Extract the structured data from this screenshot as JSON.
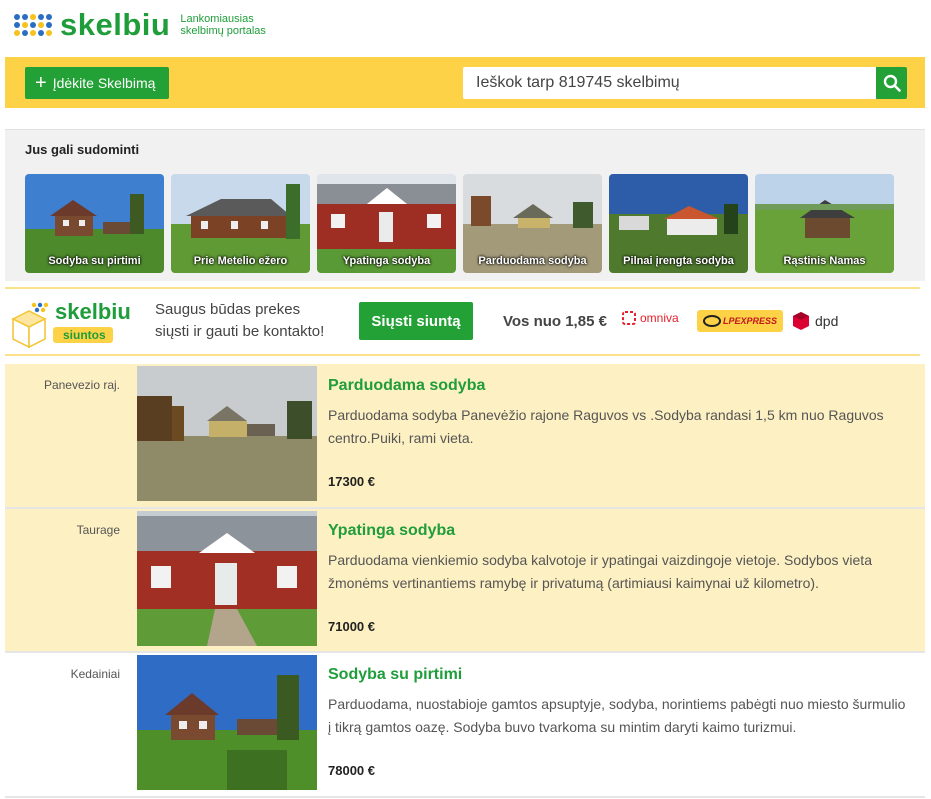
{
  "header": {
    "logo_text": "skelbiu",
    "tagline_1": "Lankomiausias",
    "tagline_2": "skelbimų portalas"
  },
  "toolbar": {
    "add_label": "Įdėkite Skelbimą",
    "search_placeholder": "Ieškok tarp 819745 skelbimų"
  },
  "recommendations": {
    "title": "Jus gali sudominti",
    "items": [
      {
        "label": "Sodyba su pirtimi"
      },
      {
        "label": "Prie Metelio ežero"
      },
      {
        "label": "Ypatinga sodyba"
      },
      {
        "label": "Parduodama sodyba"
      },
      {
        "label": "Pilnai įrengta sodyba"
      },
      {
        "label": "Rąstinis Namas"
      }
    ]
  },
  "shipping": {
    "logo_text": "skelbiu",
    "logo_sub": "siuntos",
    "text_1": "Saugus būdas prekes",
    "text_2": "siųsti ir gauti be kontakto!",
    "button": "Siųsti siuntą",
    "price": "Vos nuo 1,85 €",
    "carriers": [
      "omniva",
      "LPEXPRESS",
      "dpd"
    ]
  },
  "listings": [
    {
      "location": "Panevezio raj.",
      "title": "Parduodama sodyba",
      "description": "Parduodama sodyba Panevėžio rajone Raguvos vs .Sodyba randasi 1,5 km nuo Raguvos centro.Puiki, rami vieta.",
      "price": "17300 €",
      "highlighted": true
    },
    {
      "location": "Taurage",
      "title": "Ypatinga sodyba",
      "description": "Parduodama vienkiemio sodyba kalvotoje ir ypatingai vaizdingoje vietoje. Sodybos vieta žmonėms vertinantiems ramybę ir privatumą (artimiausi kaimynai už kilometro).",
      "price": "71000 €",
      "highlighted": true
    },
    {
      "location": "Kedainiai",
      "title": "Sodyba su pirtimi",
      "description": "Parduodama, nuostabioje gamtos apsuptyje, sodyba, norintiems pabėgti nuo miesto šurmulio į tikrą gamtos oazę. Sodyba buvo tvarkoma su mintim daryti kaimo turizmui.",
      "price": "78000 €",
      "highlighted": false
    }
  ],
  "colors": {
    "brand_green": "#1f9d3a",
    "bar_yellow": "#fdd247",
    "highlight": "#fdf0c2"
  }
}
